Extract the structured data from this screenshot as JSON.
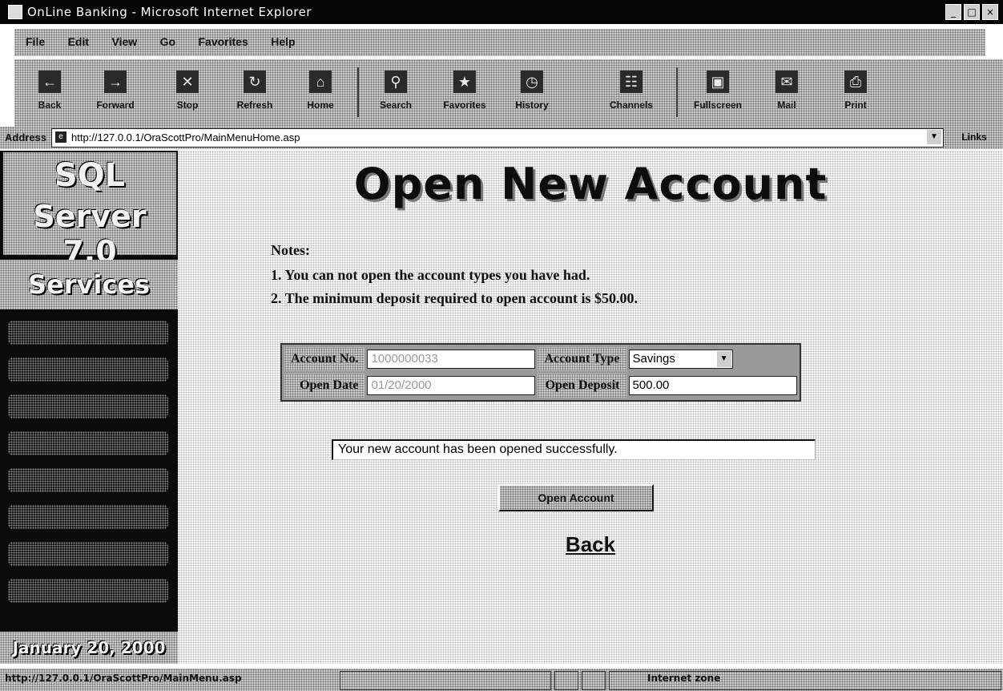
{
  "window": {
    "title": "OnLine Banking - Microsoft Internet Explorer",
    "controls": [
      "_",
      "□",
      "×"
    ]
  },
  "menu": {
    "items": [
      "File",
      "Edit",
      "View",
      "Go",
      "Favorites",
      "Help"
    ]
  },
  "toolbar": {
    "buttons": [
      "Back",
      "Forward",
      "Stop",
      "Refresh",
      "Home",
      "Search",
      "Favorites",
      "History",
      "Channels",
      "Fullscreen",
      "Mail",
      "Print"
    ]
  },
  "address": {
    "label": "Address",
    "url": "http://127.0.0.1/OraScottPro/MainMenuHome.asp",
    "go_label": "Links"
  },
  "sidebar": {
    "brand_line1": "SQL",
    "brand_line2": "Server 7.0",
    "section_title": "Services",
    "date": "January 20, 2000"
  },
  "page": {
    "heading": "Open New Account",
    "notes_title": "Notes:",
    "note1": "1. You can not open the account types you have had.",
    "note2": "2. The minimum deposit required to open account is $50.00.",
    "form": {
      "account_no_label": "Account No.",
      "account_no_value": "1000000033",
      "account_type_label": "Account Type",
      "account_type_value": "Savings",
      "open_date_label": "Open Date",
      "open_date_value": "01/20/2000",
      "open_deposit_label": "Open Deposit",
      "open_deposit_value": "500.00"
    },
    "message": "Your new account has been opened successfully.",
    "open_button": "Open Account",
    "back_link": "Back"
  },
  "status": {
    "text": "http://127.0.0.1/OraScottPro/MainMenu.asp",
    "zone": "Internet zone"
  }
}
